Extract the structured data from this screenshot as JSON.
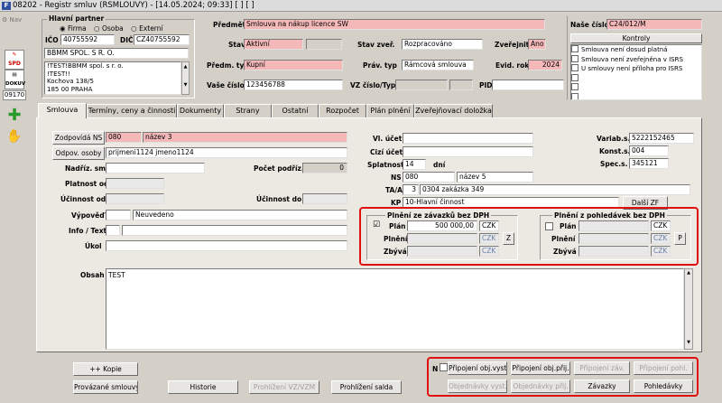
{
  "window": {
    "title": "08202 - Registr smluv (RSMLOUVY) - [14.05.2024; 09:33] [ ] [ ]"
  },
  "sidebar": {
    "nav_label": "Nav",
    "counter": "09170",
    "spd_label": "SPD",
    "dokuv_label": "DOKUV"
  },
  "partner": {
    "group": "Hlavní partner",
    "type_firma": "Firma",
    "type_osoba": "Osoba",
    "type_externi": "Externí",
    "ico_label": "IČO",
    "ico": "40755592",
    "dic_label": "DIČ",
    "dic": "CZ40755592",
    "name": "BBMM SPOL. S R. O.",
    "addr_lines": [
      "!TEST!BBMM spol. s r. o.",
      "!TEST!!",
      "Kochova 138/5",
      "185 00 PRAHA"
    ]
  },
  "header": {
    "predmet_label": "Předmět",
    "predmet": "Smlouva na nákup licence SW",
    "stav_label": "Stav",
    "stav": "Aktivní",
    "stav_zver_label": "Stav zveř.",
    "stav_zver": "Rozpracováno",
    "zverejnit_label": "Zveřejnit",
    "zverejnit": "Ano",
    "predm_typ_label": "Předm. typ",
    "predm_typ": "Kupní",
    "prav_typ_label": "Práv. typ",
    "prav_typ": "Rámcová smlouva",
    "evid_rok_label": "Evid. rok",
    "evid_rok": "2024",
    "vase_cislo_label": "Vaše číslo",
    "vase_cislo": "123456788",
    "vz_label": "VZ číslo/Typ",
    "pid_label": "PID",
    "nase_cislo_label": "Naše číslo",
    "nase_cislo": "C24/012/M",
    "kontroly_btn": "Kontroly",
    "kontroly": [
      "Smlouva není dosud platná",
      "Smlouva není zveřejněna v ISRS",
      "U smlouvy není příloha pro ISRS"
    ]
  },
  "tabs": [
    "Smlouva",
    "Termíny, ceny a činnosti",
    "Dokumenty",
    "Strany",
    "Ostatní",
    "Rozpočet",
    "Plán plnění",
    "Zveřejňovací doložka"
  ],
  "main": {
    "zodpovida_btn": "Zodpovídá NS",
    "zodp_code": "080",
    "zodp_name": "název 3",
    "odpov_btn": "Odpov. osoby",
    "odpov": "prijmeni1124 jmeno1124",
    "nadriz_label": "Nadříz. sml.",
    "pocet_label": "Počet podříz.",
    "pocet": "0",
    "platnost_od_label": "Platnost od",
    "ucinnost_od_label": "Účinnost od",
    "ucinnost_do_label": "Účinnost do",
    "vypoved_label": "Výpověď",
    "vypoved": "Neuvedeno",
    "info_label": "Info / Text",
    "ukol_label": "Úkol",
    "vl_ucet_label": "Vl. účet",
    "cizi_ucet_label": "Cizí účet",
    "splatnost_label": "Splatnost",
    "splatnost": "14",
    "dni": "dní",
    "ns_label": "NS",
    "ns_code": "080",
    "ns_name": "název 5",
    "ta_label": "TA/A",
    "ta_num": "3",
    "ta": "0304 zakázka 349",
    "kp_label": "KP",
    "kp": "10-Hlavní činnost",
    "variab_label": "Variab.s.",
    "variab": "5222152465",
    "konst_label": "Konst.s.",
    "konst": "004",
    "spec_label": "Spec.s.",
    "spec": "345121",
    "dalsi_zf": "Další ZF",
    "obsah_label": "Obsah",
    "obsah": "TEST"
  },
  "plneni_zavazku": {
    "title": "Plnění ze závazků bez DPH",
    "plan_label": "Plán",
    "plan": "500 000,00",
    "plan_curr": "CZK",
    "plneni_label": "Plnění",
    "plneni_curr": "CZK",
    "zbyva_label": "Zbývá",
    "zbyva_curr": "CZK",
    "z_btn": "Z"
  },
  "plneni_pohledavek": {
    "title": "Plnění z pohledávek bez DPH",
    "plan_label": "Plán",
    "plan_curr": "CZK",
    "plneni_label": "Plnění",
    "plneni_curr": "CZK",
    "zbyva_label": "Zbývá",
    "zbyva_curr": "CZK",
    "p_btn": "P"
  },
  "footer": {
    "kopie": "++ Kopie",
    "provazane": "Provázané smlouvy",
    "historie": "Historie",
    "prohlizeni_vz": "Prohlížení VZ/VZM",
    "prohlizeni_salda": "Prohlížení salda",
    "n_label": "N",
    "pripojeni_obj_vyst": "Připojení obj.vyst.",
    "pripojeni_obj_prij": "Připojení obj.přij.",
    "pripojeni_zav": "Připojení záv.",
    "pripojeni_pohl": "Připojení pohl.",
    "objednavky_vyst": "Objednávky vyst.",
    "objednavky_prij": "Objednávky přij.",
    "zavazky": "Závazky",
    "pohledavky": "Pohledávky"
  }
}
